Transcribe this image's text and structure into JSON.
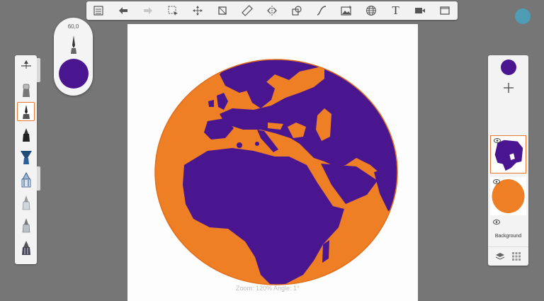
{
  "toolbar": {
    "items": [
      {
        "name": "list-icon"
      },
      {
        "name": "undo-icon"
      },
      {
        "name": "redo-icon"
      },
      {
        "name": "selection-icon"
      },
      {
        "name": "transform-icon"
      },
      {
        "name": "crop-icon"
      },
      {
        "name": "ruler-icon"
      },
      {
        "name": "symmetry-icon"
      },
      {
        "name": "shape-icon"
      },
      {
        "name": "curve-icon"
      },
      {
        "name": "image-icon"
      },
      {
        "name": "perspective-icon"
      },
      {
        "name": "text-icon"
      },
      {
        "name": "video-icon"
      },
      {
        "name": "fullscreen-icon"
      }
    ],
    "text_glyph": "T"
  },
  "brush": {
    "size": "60,0",
    "color": "#4a1690"
  },
  "tools": [
    {
      "name": "brush-settings-icon"
    },
    {
      "name": "eraser-brush-icon"
    },
    {
      "name": "pen-nib-icon"
    },
    {
      "name": "marker-nib-icon"
    },
    {
      "name": "fan-brush-icon"
    },
    {
      "name": "airbrush-icon"
    },
    {
      "name": "pencil-icon"
    },
    {
      "name": "soft-pencil-icon"
    },
    {
      "name": "fill-brush-icon"
    }
  ],
  "status": {
    "zoom_text": "Zoom: 120%  Angle: 1°"
  },
  "layers": {
    "current_color": "#4a1690",
    "background_label": "Background"
  },
  "colors": {
    "orange": "#ee7f25",
    "purple": "#4a1690",
    "accent": "#e97930"
  }
}
